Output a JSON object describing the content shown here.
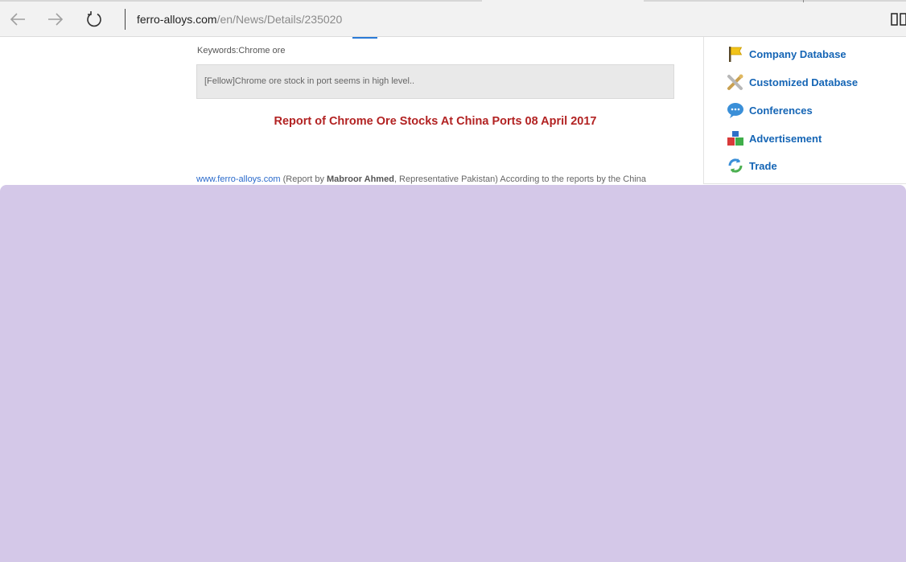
{
  "browser": {
    "address_domain": "ferro-alloys.com",
    "address_path": "/en/News/Details/235020"
  },
  "article": {
    "keywords_label": "Keywords:",
    "keywords_value": "Chrome ore",
    "summary": "[Fellow]Chrome ore stock in port seems in high level..",
    "headline": "Report of Chrome Ore Stocks At China Ports 08 April 2017",
    "byline_source": "www.ferro-alloys.com",
    "byline_pre": " (Report by ",
    "byline_author": "Mabroor Ahmed",
    "byline_post": ", Representative Pakistan) According to the reports by the China"
  },
  "sidebar": {
    "items": [
      {
        "label": "Company Database",
        "icon": "flag-icon"
      },
      {
        "label": "Customized Database",
        "icon": "tools-icon"
      },
      {
        "label": "Conferences",
        "icon": "chat-bubble-icon"
      },
      {
        "label": "Advertisement",
        "icon": "blocks-icon"
      },
      {
        "label": "Trade",
        "icon": "refresh-arrows-icon"
      }
    ]
  },
  "colors": {
    "headline": "#b22222",
    "link": "#1565b5",
    "overlay": "#d4c8e8"
  }
}
